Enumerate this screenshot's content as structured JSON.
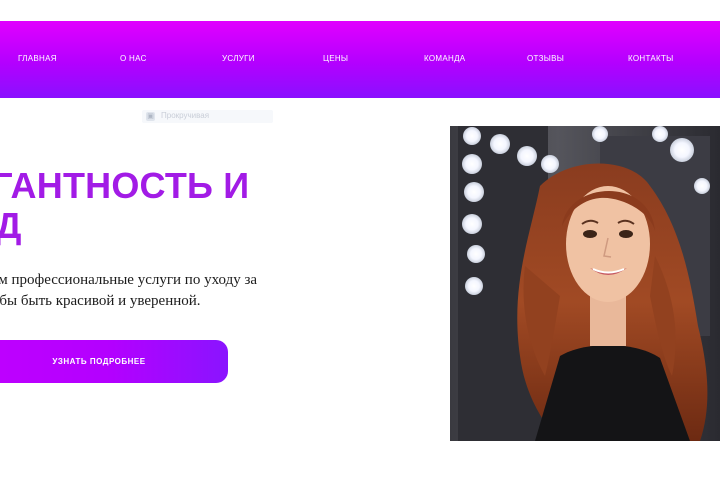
{
  "nav": {
    "items": [
      {
        "label": "ГЛАВНАЯ"
      },
      {
        "label": "О НАС"
      },
      {
        "label": "УСЛУГИ"
      },
      {
        "label": "ЦЕНЫ"
      },
      {
        "label": "КОМАНДА"
      },
      {
        "label": "ОТЗЫВЫ"
      },
      {
        "label": "КОНТАКТЫ"
      }
    ]
  },
  "placeholder": {
    "text": "Прокручивая"
  },
  "hero": {
    "title_line1": "ЕГАНТНОСТЬ И",
    "title_line2": "ОД",
    "subtitle_line1": "ваем профессиональные услуги по уходу за",
    "subtitle_line2": "чтобы быть красивой и уверенной.",
    "cta_label": "УЗНАТЬ ПОДРОБНЕЕ"
  },
  "colors": {
    "nav_gradient_start": "#e100ff",
    "nav_gradient_end": "#8a10ff",
    "title": "#a21be6",
    "cta_start": "#c000ff",
    "cta_end": "#8a14ff"
  },
  "icons": {
    "placeholder_icon": "image-placeholder-icon"
  }
}
